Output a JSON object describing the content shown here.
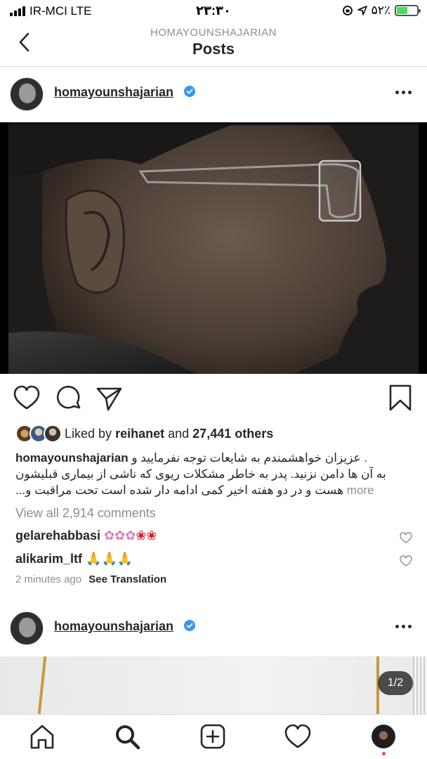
{
  "status_bar": {
    "carrier": "IR-MCI  LTE",
    "time": "۲۳:۳۰",
    "battery": "۵۲٪",
    "battery_level": 0.52
  },
  "nav": {
    "subtitle": "HOMAYOUNSHAJARIAN",
    "title": "Posts"
  },
  "post": {
    "username": "homayounshajarian",
    "liked_by": "Liked by",
    "liked_user": "reihanet",
    "and": "and",
    "others": "27,441 others",
    "caption_line1": ". عزیزان خواهشمندم به شایعات توجه نفرمایید و",
    "caption_line2": "به آن ها دامن نزنید. پدر به خاطر مشکلات ریوی که ناشی از بیماری قبلیشون",
    "caption_line3": "هست و در دو هفته اخیر کمی ادامه دار شده است تحت مراقبت و...",
    "more": "more",
    "view_all": "View all 2,914 comments",
    "comments": [
      {
        "user": "gelarehabbasi",
        "text": "💐💐💐🌹🌹"
      },
      {
        "user": "alikarim_ltf",
        "text": "🙏🙏🙏"
      }
    ],
    "time": "2 minutes ago",
    "see_translation": "See Translation"
  },
  "post2": {
    "username": "homayounshajarian",
    "pager": "1/2"
  },
  "colors": {
    "verified": "#3897f0",
    "text": "#262626",
    "muted": "#8e8e8e",
    "notification": "#ed4956"
  },
  "icons": {
    "status": [
      "signal-icon",
      "location-icon",
      "rotation-lock-icon",
      "battery-icon"
    ],
    "actions": [
      "heart-icon",
      "comment-icon",
      "share-icon",
      "bookmark-icon"
    ],
    "tabs": [
      "home-icon",
      "search-icon",
      "add-icon",
      "activity-icon",
      "profile-avatar"
    ]
  }
}
